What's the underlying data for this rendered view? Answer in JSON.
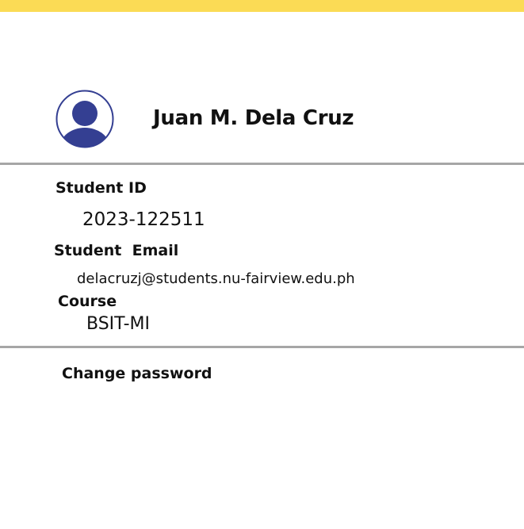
{
  "colors": {
    "accent_bar": "#fbdb55",
    "avatar": "#343f92",
    "divider": "#a6a6a6"
  },
  "profile": {
    "avatar_icon": "user-avatar-icon",
    "name": "Juan M. Dela Cruz"
  },
  "details": {
    "student_id_label": "Student ID",
    "student_id_value": "2023-122511",
    "email_label": "Student  Email",
    "email_value": "delacruzj@students.nu-fairview.edu.ph",
    "course_label": "Course",
    "course_value": "BSIT-MI"
  },
  "actions": {
    "change_password": "Change password"
  }
}
